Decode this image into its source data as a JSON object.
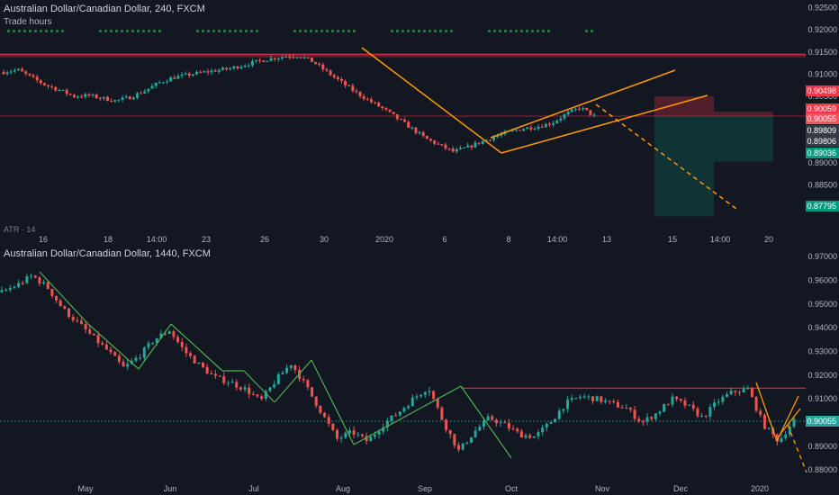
{
  "top_pane": {
    "title": "Australian Dollar/Canadian Dollar, 240, FXCM",
    "subtitle": "Trade hours",
    "indicator_stub": "ATR · 14",
    "y_ticks": [
      "0.92500",
      "0.92000",
      "0.91500",
      "0.91000",
      "0.90500",
      "0.90000",
      "0.89500",
      "0.88500",
      "0.88000",
      "0.90000"
    ],
    "x_ticks": [
      "16",
      "18",
      "14:00",
      "23",
      "26",
      "30",
      "2020",
      "6",
      "8",
      "14:00",
      "13",
      "15",
      "14:00",
      "20"
    ],
    "price_tags": [
      {
        "label": "0.90498",
        "color": "#f23645"
      },
      {
        "label": "0.90059",
        "color": "#f23645"
      },
      {
        "label": "0.90055",
        "color": "#f7525f"
      },
      {
        "label": "0.89809",
        "color": "#363a45"
      },
      {
        "label": "0.89806",
        "color": "#363a45"
      },
      {
        "label": "0.89036",
        "color": "#089981"
      },
      {
        "label": "0.87795",
        "color": "#089981"
      }
    ]
  },
  "bottom_pane": {
    "title": "Australian Dollar/Canadian Dollar, 1440, FXCM",
    "y_ticks": [
      "0.97000",
      "0.96000",
      "0.95000",
      "0.94000",
      "0.93000",
      "0.92000",
      "0.91000",
      "0.89000",
      "0.88000"
    ],
    "x_ticks": [
      "May",
      "Jun",
      "Jul",
      "Aug",
      "Sep",
      "Oct",
      "Nov",
      "Dec",
      "2020"
    ],
    "price_tag": {
      "label": "0.90055",
      "color": "#26a69a"
    }
  },
  "chart_data": [
    {
      "type": "candlestick",
      "title": "Australian Dollar/Canadian Dollar, 240, FXCM",
      "timeframe": "240",
      "ylim": [
        0.876,
        0.9255
      ],
      "close_path": [
        0.9105,
        0.911,
        0.9092,
        0.9075,
        0.9064,
        0.905,
        0.9052,
        0.9046,
        0.904,
        0.9048,
        0.9062,
        0.908,
        0.9092,
        0.9098,
        0.9103,
        0.9108,
        0.9112,
        0.912,
        0.9128,
        0.9135,
        0.914,
        0.9142,
        0.9128,
        0.9105,
        0.9082,
        0.906,
        0.904,
        0.9022,
        0.9,
        0.8978,
        0.8955,
        0.894,
        0.8925,
        0.8935,
        0.8948,
        0.896,
        0.897,
        0.8978,
        0.8982,
        0.899,
        0.901,
        0.9025,
        0.9006
      ],
      "last_price": 0.90055,
      "position": {
        "entry": 0.90059,
        "stop": 0.90498,
        "target": 0.87795
      }
    },
    {
      "type": "candlestick",
      "title": "Australian Dollar/Canadian Dollar, 1440, FXCM",
      "timeframe": "1440",
      "ylim": [
        0.877,
        0.9735
      ],
      "close_path": [
        0.955,
        0.958,
        0.962,
        0.957,
        0.948,
        0.942,
        0.936,
        0.93,
        0.923,
        0.928,
        0.935,
        0.939,
        0.93,
        0.924,
        0.919,
        0.917,
        0.914,
        0.909,
        0.918,
        0.925,
        0.915,
        0.904,
        0.893,
        0.896,
        0.892,
        0.899,
        0.904,
        0.91,
        0.915,
        0.9,
        0.888,
        0.896,
        0.902,
        0.899,
        0.895,
        0.894,
        0.9,
        0.908,
        0.911,
        0.91,
        0.908,
        0.906,
        0.9,
        0.904,
        0.91,
        0.907,
        0.902,
        0.909,
        0.913,
        0.914,
        0.899,
        0.892,
        0.901
      ],
      "last_price": 0.90055
    }
  ]
}
